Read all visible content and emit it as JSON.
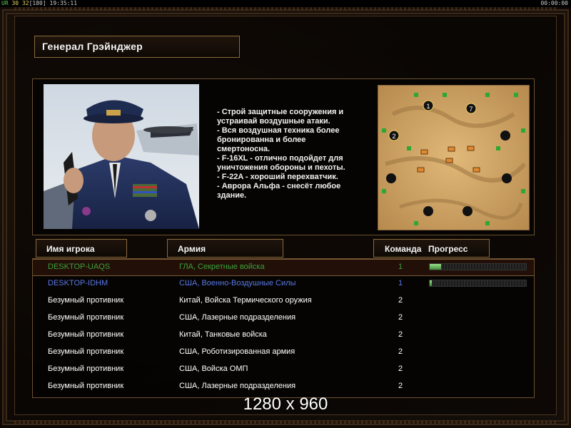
{
  "statusbar": {
    "ur_label": "UR",
    "fps1": "30",
    "fps2": "32",
    "bracket_value": "[180]",
    "clock": "19:35:11",
    "timer": "00:00:00"
  },
  "general": {
    "title": "Генерал Грэйнджер"
  },
  "description": [
    "- Строй защитные сооружения и",
    " устраивай воздушные атаки.",
    "- Вся воздушная техника более",
    " бронированна и более",
    " смертоносна.",
    "- F-16XL - отлично подойдет для",
    " уничтожения обороны и пехоты.",
    "- F-22A - хороший перехватчик.",
    "- Аврора Альфа - снесёт любое",
    " здание."
  ],
  "map": {
    "start_numbers": [
      "1",
      "7",
      "2"
    ]
  },
  "headers": {
    "player": "Имя игрока",
    "army": "Армия",
    "team": "Команда",
    "progress": "Прогресс"
  },
  "players": [
    {
      "name": "DESKTOP-UAQS",
      "army": "ГЛА, Секретные войска",
      "team": "1",
      "color": "#3aa13a",
      "progress": 0.12,
      "selected": true
    },
    {
      "name": "DESKTOP-IDHM",
      "army": "США, Военно-Воздушные Силы",
      "team": "1",
      "color": "#5a78e6",
      "progress": 0.02,
      "selected": false
    },
    {
      "name": "Безумный противник",
      "army": "Китай, Войска Термического оружия",
      "team": "2",
      "color": "#ffffff",
      "progress": null,
      "selected": false
    },
    {
      "name": "Безумный противник",
      "army": "США, Лазерные подразделения",
      "team": "2",
      "color": "#ffffff",
      "progress": null,
      "selected": false
    },
    {
      "name": "Безумный противник",
      "army": "Китай, Танковые войска",
      "team": "2",
      "color": "#ffffff",
      "progress": null,
      "selected": false
    },
    {
      "name": "Безумный противник",
      "army": "США, Роботизированная армия",
      "team": "2",
      "color": "#ffffff",
      "progress": null,
      "selected": false
    },
    {
      "name": "Безумный противник",
      "army": "США, Войска ОМП",
      "team": "2",
      "color": "#ffffff",
      "progress": null,
      "selected": false
    },
    {
      "name": "Безумный противник",
      "army": "США, Лазерные подразделения",
      "team": "2",
      "color": "#ffffff",
      "progress": null,
      "selected": false
    }
  ],
  "resolution_text": "1280 x 960"
}
